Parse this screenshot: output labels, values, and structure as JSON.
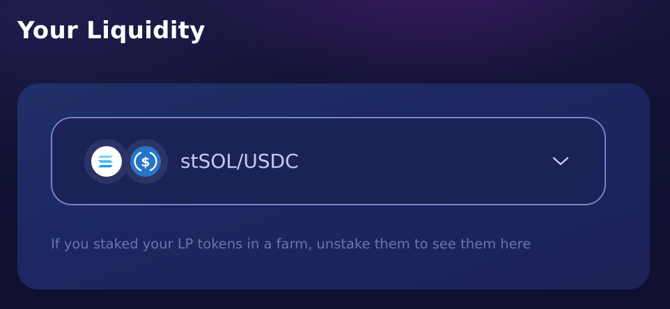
{
  "header": {
    "title": "Your Liquidity"
  },
  "liquidity": {
    "selected_pool": {
      "label": "stSOL/USDC",
      "token_a_icon": "stsol-logo-icon",
      "token_b_icon": "usdc-logo-icon"
    },
    "dropdown_icon": "chevron-down-icon",
    "hint": "If you staked your LP tokens in a farm, unstake them to see them here"
  },
  "colors": {
    "background": "#111233",
    "card": "#1d2860",
    "select_border": "#7b83c8",
    "title_text": "#ffffff",
    "pair_text": "#c7ccf0",
    "hint_text": "#6b74ad",
    "usdc_blue": "#2775ca",
    "stsol_cyan": "#3fb7f5"
  }
}
